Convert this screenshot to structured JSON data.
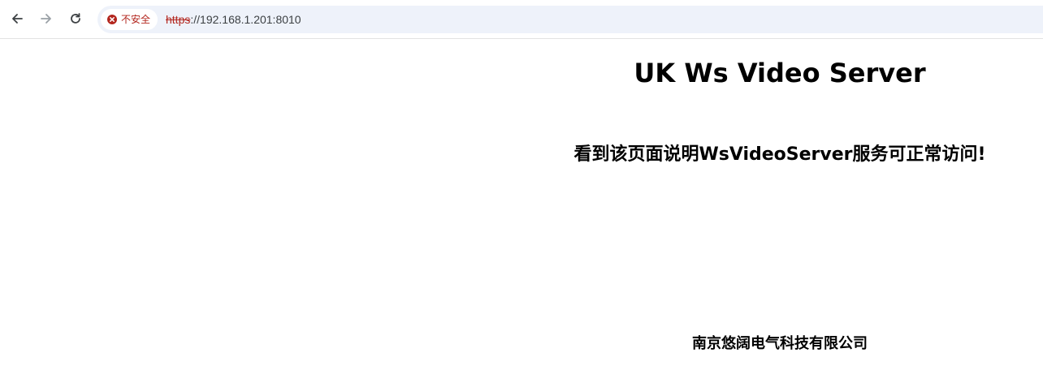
{
  "browser": {
    "security_chip_label": "不安全",
    "url_scheme": "https",
    "url_rest": "://192.168.1.201:8010",
    "icons": {
      "back": "back-arrow-icon",
      "forward": "forward-arrow-icon",
      "reload": "reload-icon",
      "security": "not-secure-warning-icon"
    },
    "colors": {
      "warning": "#b3261e",
      "omnibox": "#eef2fa"
    }
  },
  "page": {
    "title": "UK Ws Video Server",
    "subtitle": "看到该页面说明WsVideoServer服务可正常访问!",
    "company": "南京悠阔电气科技有限公司"
  }
}
